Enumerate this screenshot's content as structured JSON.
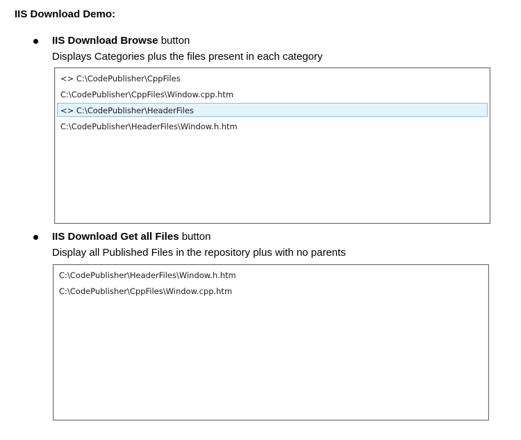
{
  "title": "IIS Download Demo:",
  "sections": [
    {
      "label_bold": "IIS Download Browse",
      "label_rest": " button",
      "description": "Displays Categories plus the files present in each category",
      "items": [
        {
          "text": "<> C:\\CodePublisher\\CppFiles",
          "selected": false
        },
        {
          "text": "C:\\CodePublisher\\CppFiles\\Window.cpp.htm",
          "selected": false
        },
        {
          "text": "<> C:\\CodePublisher\\HeaderFiles",
          "selected": true
        },
        {
          "text": "C:\\CodePublisher\\HeaderFiles\\Window.h.htm",
          "selected": false
        }
      ]
    },
    {
      "label_bold": "IIS Download Get all Files",
      "label_rest": " button",
      "description": "Display all Published Files in the repository plus with no parents",
      "items": [
        {
          "text": "C:\\CodePublisher\\HeaderFiles\\Window.h.htm",
          "selected": false
        },
        {
          "text": "C:\\CodePublisher\\CppFiles\\Window.cpp.htm",
          "selected": false
        }
      ]
    }
  ],
  "colors": {
    "selection_background": "#e5f3fb",
    "selection_border": "#7fc3e6",
    "listbox_border": "#6e6e6e"
  }
}
